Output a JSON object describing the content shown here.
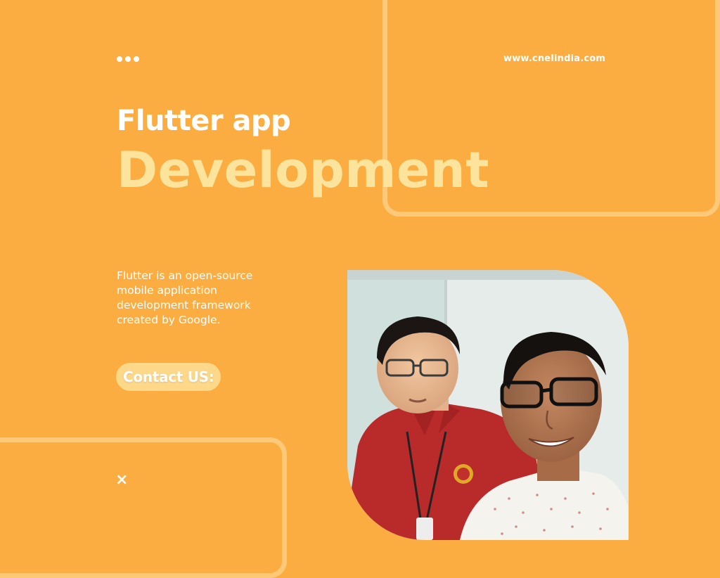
{
  "header": {
    "website": "www.cnelindia.com"
  },
  "hero": {
    "title_line1": "Flutter app",
    "title_line2": "Development",
    "description": "Flutter is an open-source mobile application development framework created by Google."
  },
  "cta": {
    "label": "Contact US:"
  },
  "footer": {
    "close_glyph": "×"
  },
  "photo": {
    "description": "Two men posing for a selfie indoors"
  },
  "colors": {
    "background": "#FBAD41",
    "accent_light": "#FDE49C",
    "frame": "#FDC877",
    "button_bg": "#FDD889",
    "text": "#FFFFFF"
  },
  "icons": {
    "menu": "dots-icon",
    "close": "close-icon"
  }
}
